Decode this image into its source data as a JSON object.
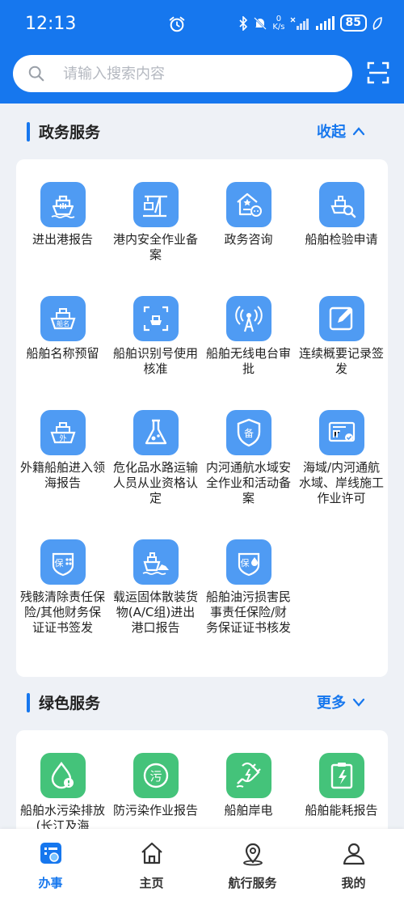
{
  "status_bar": {
    "time": "12:13",
    "net_speed_value": "0",
    "net_speed_unit": "K/s",
    "battery": "85"
  },
  "search": {
    "placeholder": "请输入搜索内容"
  },
  "government_section": {
    "title": "政务服务",
    "action_label": "收起",
    "items": [
      {
        "label": "进出港报告",
        "icon": "ship-icon"
      },
      {
        "label": "港内安全作业备案",
        "icon": "crane-icon"
      },
      {
        "label": "政务咨询",
        "icon": "consult-icon"
      },
      {
        "label": "船舶检验申请",
        "icon": "ship-inspect-icon"
      },
      {
        "label": "船舶名称预留",
        "icon": "ship-name-icon"
      },
      {
        "label": "船舶识别号使用核准",
        "icon": "ship-id-icon"
      },
      {
        "label": "船舶无线电台审批",
        "icon": "radio-tower-icon"
      },
      {
        "label": "连续概要记录签发",
        "icon": "edit-record-icon"
      },
      {
        "label": "外籍船舶进入领海报告",
        "icon": "foreign-ship-icon"
      },
      {
        "label": "危化品水路运输人员从业资格认定",
        "icon": "flask-icon"
      },
      {
        "label": "内河通航水域安全作业和活动备案",
        "icon": "shield-record-icon"
      },
      {
        "label": "海域/内河通航水域、岸线施工作业许可",
        "icon": "permit-icon"
      },
      {
        "label": "残骸清除责任保险/其他财务保证证书签发",
        "icon": "insurance-icon"
      },
      {
        "label": "载运固体散装货物(A/C组)进出港口报告",
        "icon": "bulk-cargo-icon"
      },
      {
        "label": "船舶油污损害民事责任保险/财务保证证书核发",
        "icon": "oil-insurance-icon"
      }
    ]
  },
  "green_section": {
    "title": "绿色服务",
    "action_label": "更多",
    "items": [
      {
        "label": "船舶水污染排放(长江及海",
        "icon": "water-pollution-icon"
      },
      {
        "label": "防污染作业报告",
        "icon": "anti-pollution-icon"
      },
      {
        "label": "船舶岸电",
        "icon": "shore-power-icon"
      },
      {
        "label": "船舶能耗报告",
        "icon": "energy-report-icon"
      }
    ]
  },
  "bottom_nav": {
    "items": [
      {
        "label": "办事",
        "active": true
      },
      {
        "label": "主页"
      },
      {
        "label": "航行服务"
      },
      {
        "label": "我的"
      }
    ]
  },
  "colors": {
    "primary": "#1677ee",
    "icon_blue": "#4f9bf3",
    "icon_green": "#44c37a",
    "background": "#eef1f6"
  }
}
